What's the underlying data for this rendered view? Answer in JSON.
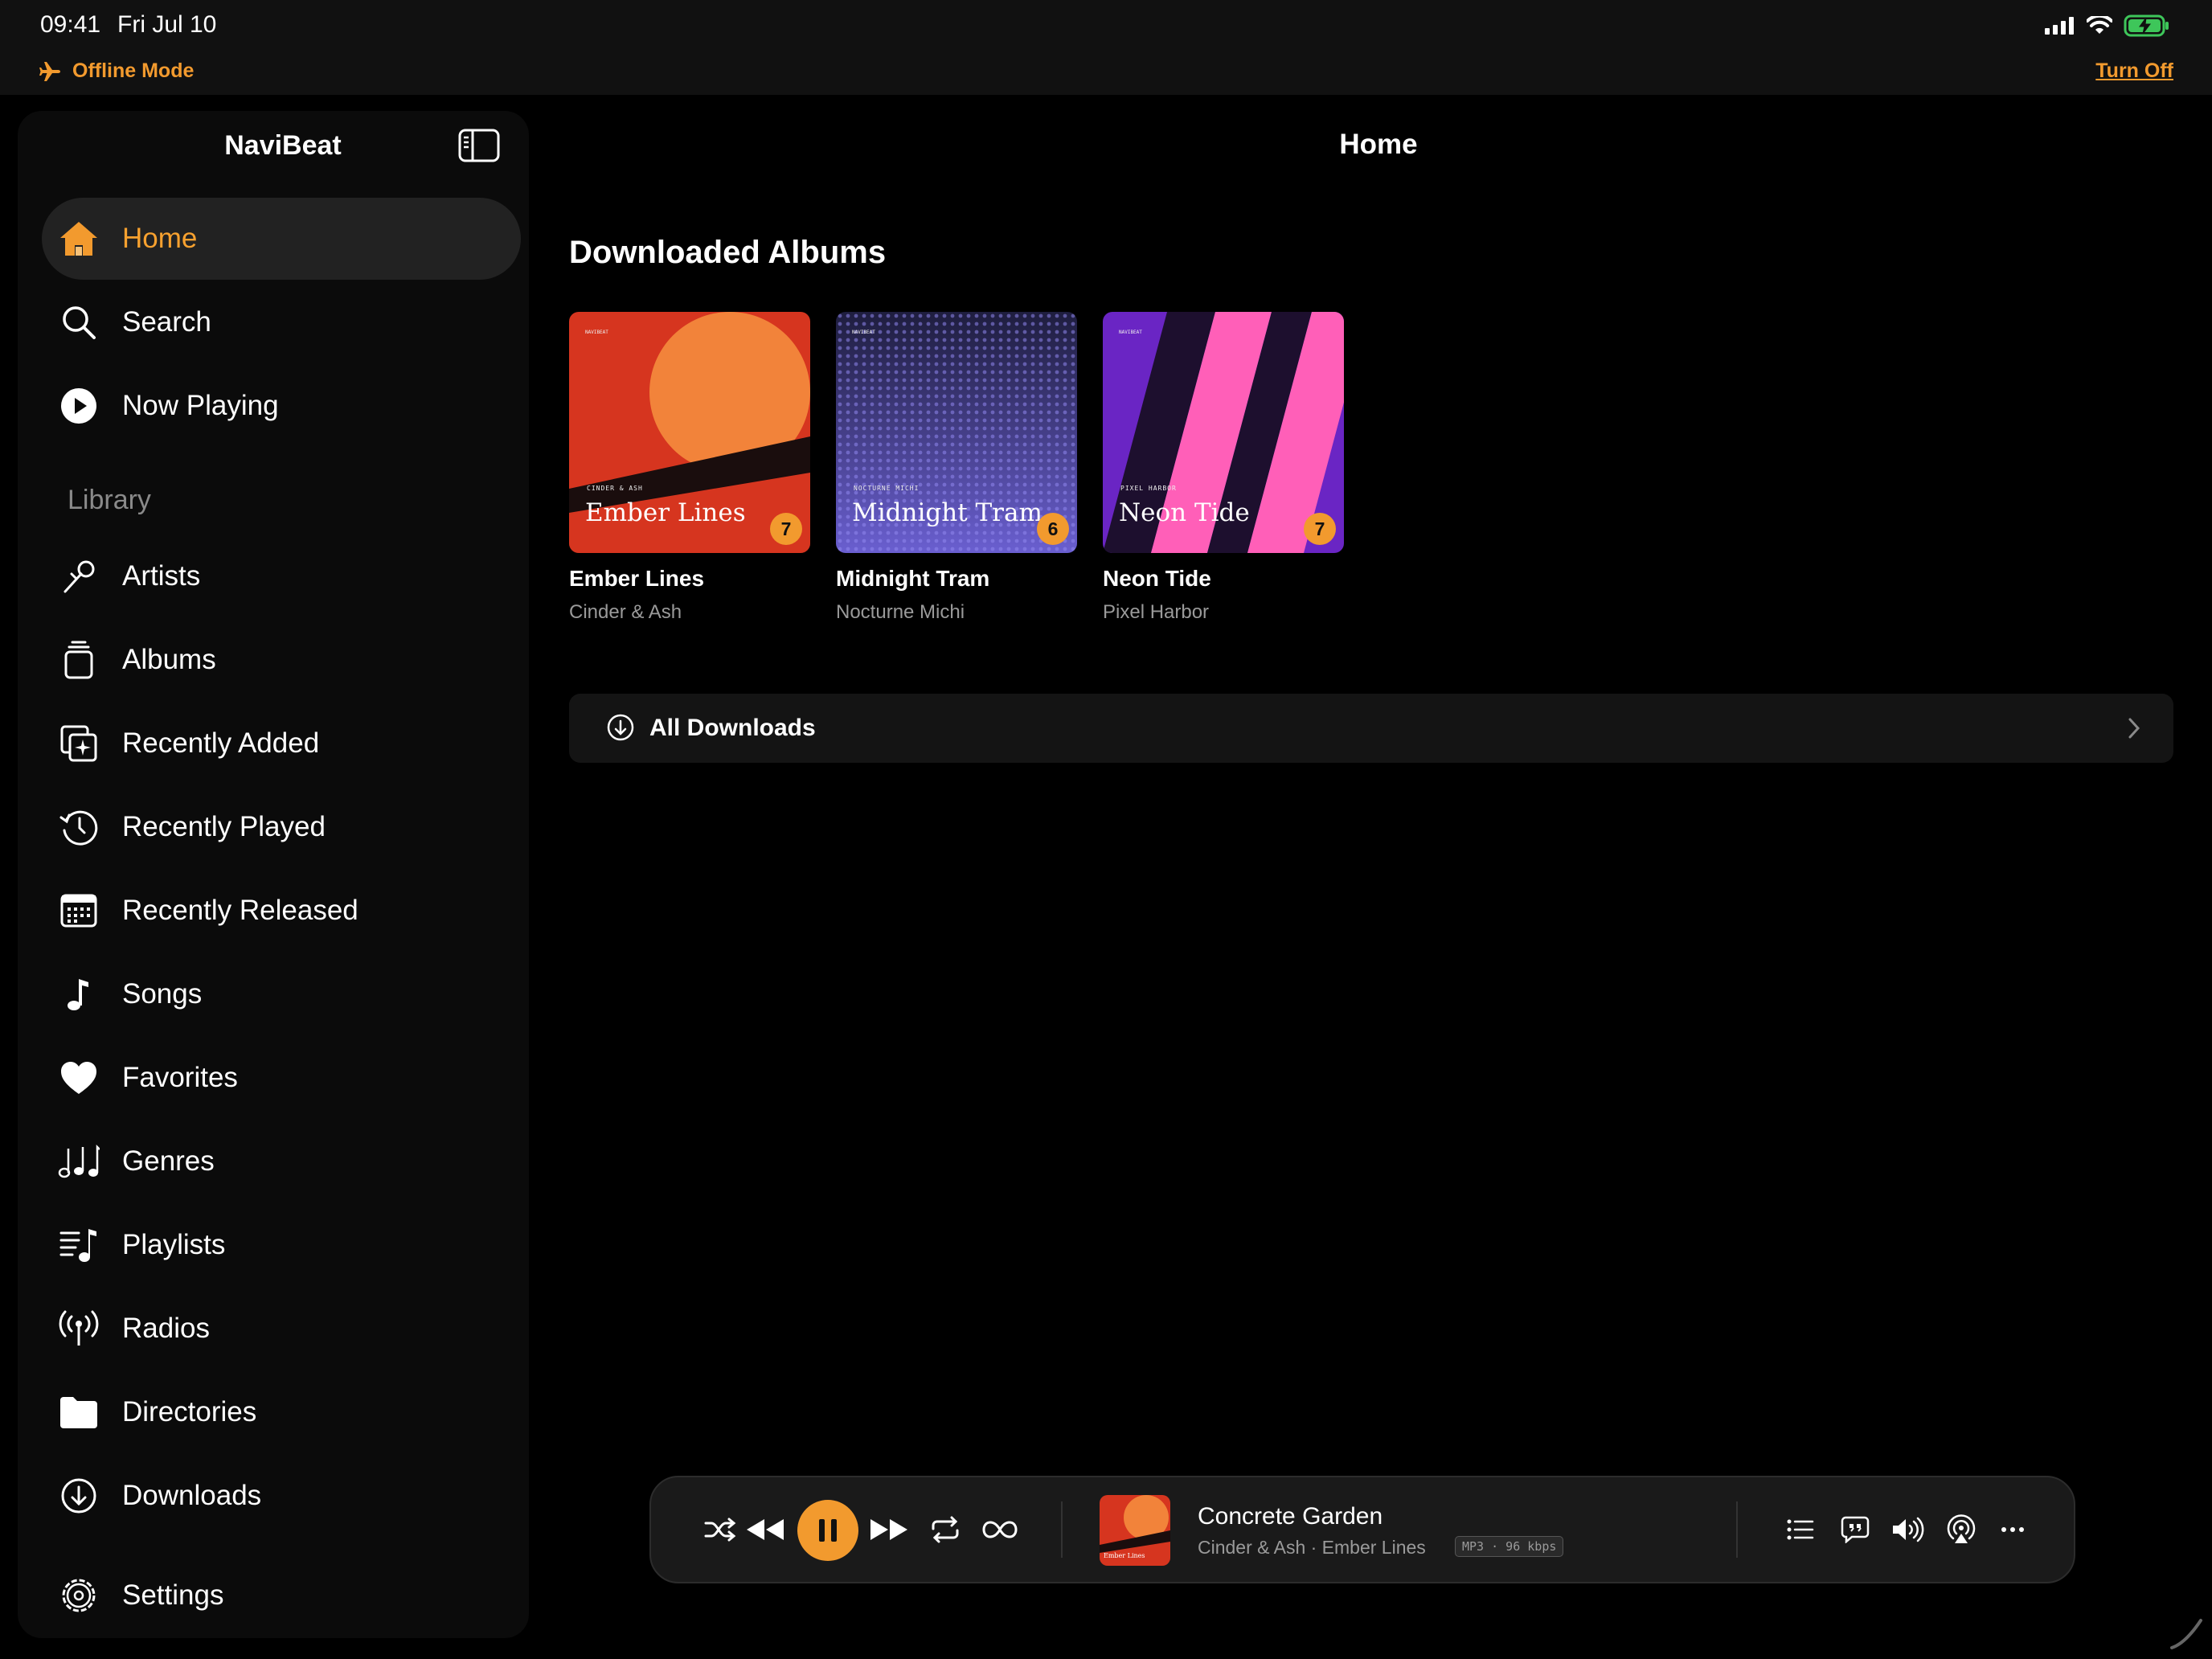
{
  "status_bar": {
    "time": "09:41",
    "date": "Fri Jul 10",
    "offline_label": "Offline Mode",
    "turn_off_label": "Turn Off"
  },
  "sidebar": {
    "app_title": "NaviBeat",
    "main_items": [
      {
        "label": "Home",
        "icon": "house-icon",
        "active": true
      },
      {
        "label": "Search",
        "icon": "magnifier-icon"
      },
      {
        "label": "Now Playing",
        "icon": "play-circle-icon"
      }
    ],
    "library_heading": "Library",
    "library_items": [
      {
        "label": "Artists",
        "icon": "microphone-icon"
      },
      {
        "label": "Albums",
        "icon": "album-stack-icon"
      },
      {
        "label": "Recently Added",
        "icon": "sparkle-square-icon"
      },
      {
        "label": "Recently Played",
        "icon": "history-clock-icon"
      },
      {
        "label": "Recently Released",
        "icon": "calendar-icon"
      },
      {
        "label": "Songs",
        "icon": "music-note-icon"
      },
      {
        "label": "Favorites",
        "icon": "heart-icon"
      },
      {
        "label": "Genres",
        "icon": "music-notes-icon"
      },
      {
        "label": "Playlists",
        "icon": "playlist-icon"
      },
      {
        "label": "Radios",
        "icon": "antenna-icon"
      },
      {
        "label": "Directories",
        "icon": "folder-icon"
      },
      {
        "label": "Downloads",
        "icon": "download-circle-icon"
      }
    ],
    "settings_label": "Settings"
  },
  "main": {
    "page_title": "Home",
    "section_title": "Downloaded Albums",
    "albums": [
      {
        "title": "Ember Lines",
        "artist": "Cinder & Ash",
        "cover_artist": "CINDER & ASH",
        "count": "7"
      },
      {
        "title": "Midnight Tram",
        "artist": "Nocturne Michi",
        "cover_artist": "NOCTURNE MICHI",
        "count": "6"
      },
      {
        "title": "Neon Tide",
        "artist": "Pixel Harbor",
        "cover_artist": "PIXEL HARBOR",
        "count": "7"
      }
    ],
    "all_downloads_label": "All Downloads"
  },
  "player": {
    "track_title": "Concrete Garden",
    "track_subtitle": "Cinder & Ash · Ember Lines",
    "format": "MP3 · 96 kbps",
    "cover_caption": "Ember Lines"
  },
  "colors": {
    "accent": "#f29a2e",
    "background": "#000000",
    "sidebar": "#0b0b0b",
    "panel": "#141414"
  }
}
